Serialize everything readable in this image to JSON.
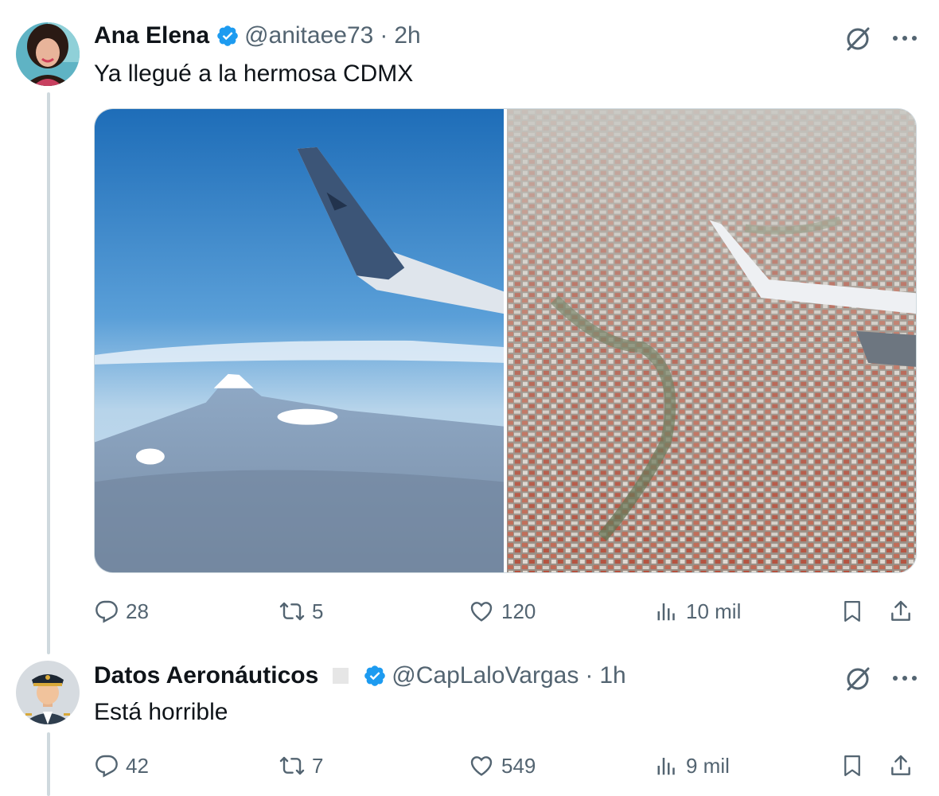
{
  "tweets": [
    {
      "author": "Ana Elena",
      "handle": "@anitaee73",
      "time": "2h",
      "text": "Ya llegué a la hermosa CDMX",
      "verified": true,
      "media": [
        "airplane-wing-over-popocatepetl-photo",
        "airplane-wing-over-mexico-city-photo"
      ],
      "stats": {
        "replies": "28",
        "reposts": "5",
        "likes": "120",
        "views": "10 mil"
      }
    },
    {
      "author": "Datos Aeronáuticos",
      "handle": "@CapLaloVargas",
      "time": "1h",
      "text": "Está horrible",
      "verified": true,
      "stats": {
        "replies": "42",
        "reposts": "7",
        "likes": "549",
        "views": "9 mil"
      }
    }
  ],
  "separator": "·",
  "icons": [
    "grok-icon",
    "more-icon",
    "reply-icon",
    "repost-icon",
    "like-icon",
    "views-icon",
    "bookmark-icon",
    "share-icon",
    "verified-badge-icon"
  ],
  "colors": {
    "verified": "#1d9bf0",
    "text": "#0f1419",
    "secondary": "#536471",
    "thread_line": "#cfd9de"
  }
}
